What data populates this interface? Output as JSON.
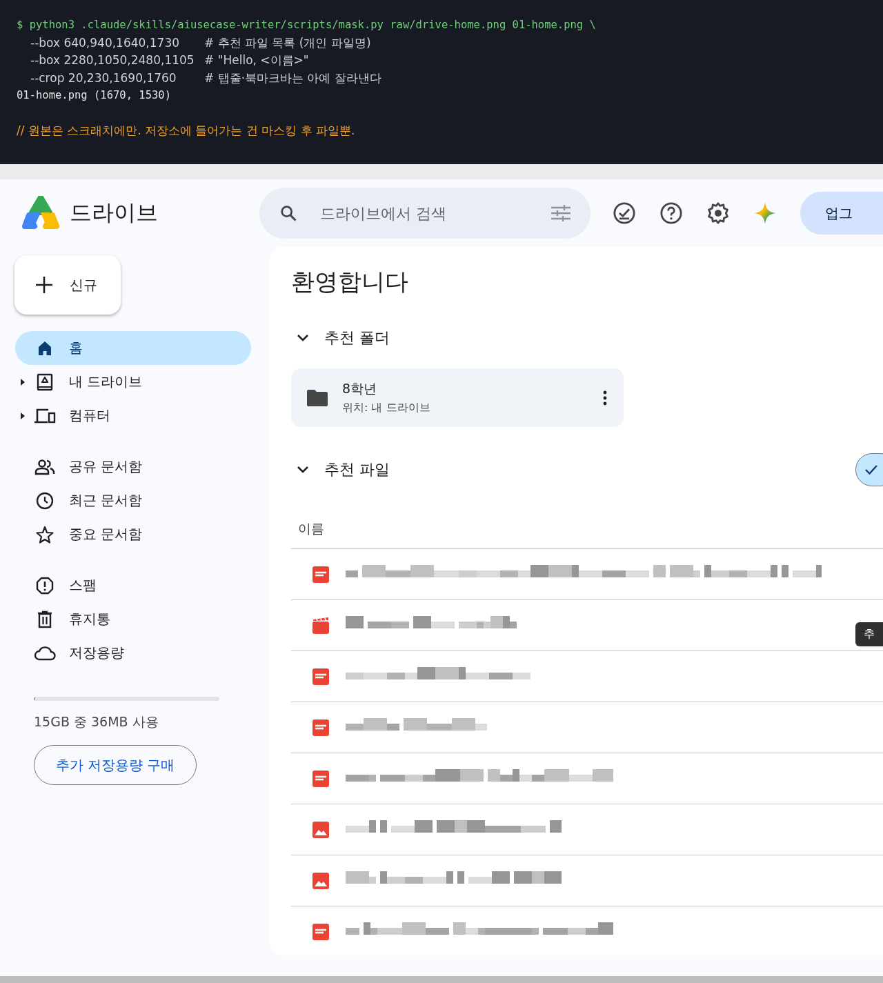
{
  "terminal": {
    "lines": [
      {
        "kind": "command",
        "text": "$ python3 .claude/skills/aiusecase-writer/scripts/mask.py raw/drive-home.png 01-home.png \\"
      },
      {
        "kind": "arg",
        "text": "--box 640,940,1640,1730",
        "note": "# 추천 파일 목록 (개인 파일명)"
      },
      {
        "kind": "arg",
        "text": "--box 2280,1050,2480,1105",
        "note": "# \"Hello, <이름>\""
      },
      {
        "kind": "arg",
        "text": "--crop 20,230,1690,1760",
        "note": "# 탭줄·북마크바는 아예 잘라낸다"
      },
      {
        "kind": "output",
        "text": "01-home.png (1670, 1530)"
      },
      {
        "kind": "comment",
        "text": "// 원본은 스크래치에만. 저장소에 들어가는 건 마스킹 후 파일뿐."
      }
    ]
  },
  "app": {
    "title": "드라이브",
    "search": {
      "placeholder": "드라이브에서 검색"
    },
    "upgrade_button": "업그",
    "new_button": "신규",
    "nav": [
      [
        {
          "label": "홈",
          "selected": true,
          "expandable": false
        },
        {
          "label": "내 드라이브",
          "selected": false,
          "expandable": true
        },
        {
          "label": "컴퓨터",
          "selected": false,
          "expandable": true
        }
      ],
      [
        {
          "label": "공유 문서함",
          "selected": false,
          "expandable": false
        },
        {
          "label": "최근 문서함",
          "selected": false,
          "expandable": false
        },
        {
          "label": "중요 문서함",
          "selected": false,
          "expandable": false
        }
      ],
      [
        {
          "label": "스팸",
          "selected": false,
          "expandable": false
        },
        {
          "label": "휴지통",
          "selected": false,
          "expandable": false
        },
        {
          "label": "저장용량",
          "selected": false,
          "expandable": false
        }
      ]
    ],
    "storage": {
      "level": 0.0024,
      "text": "15GB 중 36MB 사용",
      "buy_button": "추가 저장용량 구매"
    },
    "main": {
      "heading": "환영합니다",
      "folders_section": {
        "title": "추천 폴더",
        "expanded": true
      },
      "folders": [
        {
          "name": "8학년",
          "location": "위치: 내 드라이브"
        }
      ],
      "files_section": {
        "title": "추천 파일",
        "expanded": true
      },
      "column": "이름",
      "files": [
        {
          "kind": "pdf"
        },
        {
          "kind": "video"
        },
        {
          "kind": "pdf"
        },
        {
          "kind": "pdf"
        },
        {
          "kind": "pdf"
        },
        {
          "kind": "image"
        },
        {
          "kind": "image"
        },
        {
          "kind": "pdf"
        }
      ],
      "tooltip": "추"
    }
  }
}
